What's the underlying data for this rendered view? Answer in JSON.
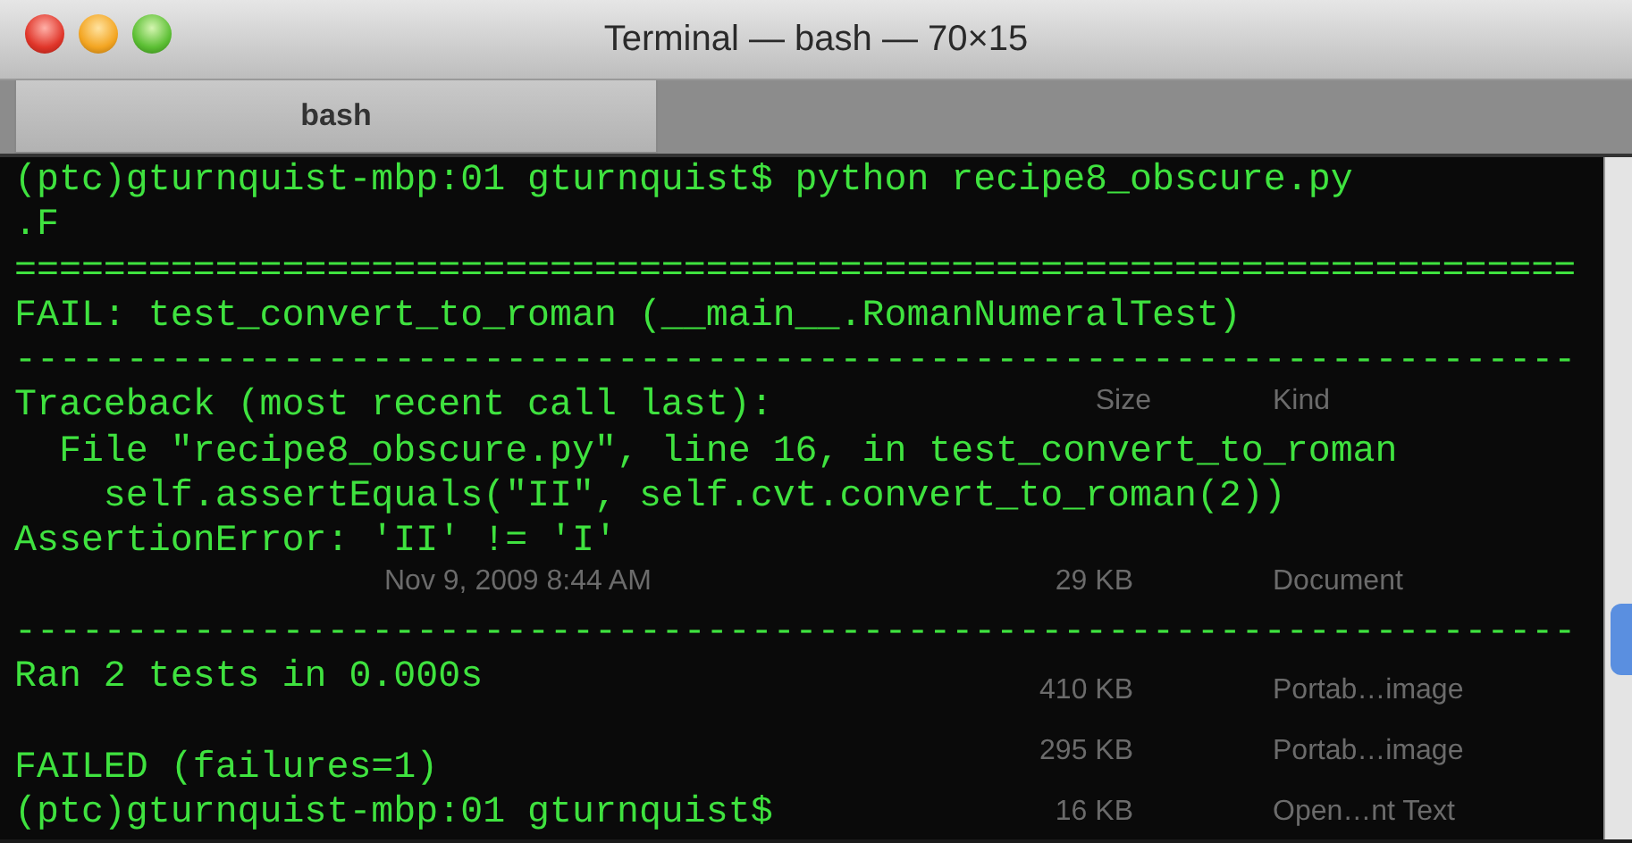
{
  "window": {
    "title": "Terminal — bash — 70×15"
  },
  "tabs": [
    {
      "label": "bash",
      "selected": true
    }
  ],
  "terminal": {
    "lines": [
      {
        "kind": "text",
        "text": "(ptc)gturnquist-mbp:01 gturnquist$ python recipe8_obscure.py"
      },
      {
        "kind": "text",
        "text": ".F"
      },
      {
        "kind": "text",
        "text": "======================================================================"
      },
      {
        "kind": "text",
        "text": "FAIL: test_convert_to_roman (__main__.RomanNumeralTest)"
      },
      {
        "kind": "text",
        "text": "----------------------------------------------------------------------"
      },
      {
        "kind": "text",
        "text": "Traceback (most recent call last):"
      },
      {
        "kind": "text",
        "text": "  File \"recipe8_obscure.py\", line 16, in test_convert_to_roman"
      },
      {
        "kind": "text",
        "text": "    self.assertEquals(\"II\", self.cvt.convert_to_roman(2))"
      },
      {
        "kind": "text",
        "text": "AssertionError: 'II' != 'I'"
      },
      {
        "kind": "blank"
      },
      {
        "kind": "text",
        "text": "----------------------------------------------------------------------"
      },
      {
        "kind": "text",
        "text": "Ran 2 tests in 0.000s"
      },
      {
        "kind": "blank"
      },
      {
        "kind": "text",
        "text": "FAILED (failures=1)"
      },
      {
        "kind": "text",
        "text": "(ptc)gturnquist-mbp:01 gturnquist$"
      }
    ]
  },
  "background_window": {
    "header": {
      "size": "Size",
      "kind": "Kind"
    },
    "rows": [
      {
        "date": "Nov 9, 2009 8:44 AM",
        "size": "29 KB",
        "kind": "Document"
      },
      {
        "size": "410 KB",
        "kind": "Portab…image"
      },
      {
        "size": "295 KB",
        "kind": "Portab…image"
      },
      {
        "size": "16 KB",
        "kind": "Open…nt Text"
      }
    ]
  }
}
